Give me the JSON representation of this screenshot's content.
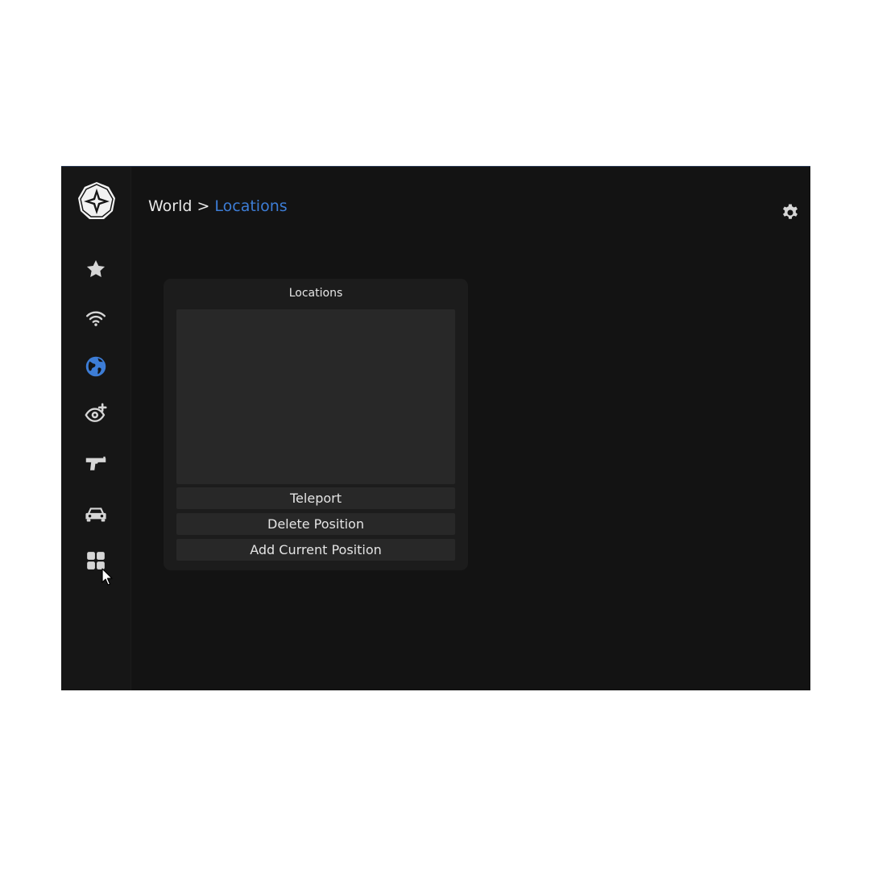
{
  "breadcrumb": {
    "parent": "World",
    "separator": ">",
    "current": "Locations"
  },
  "sidebar": {
    "items": [
      {
        "icon": "star-icon",
        "active": false
      },
      {
        "icon": "wifi-icon",
        "active": false
      },
      {
        "icon": "globe-icon",
        "active": true
      },
      {
        "icon": "eye-plus-icon",
        "active": false
      },
      {
        "icon": "pistol-icon",
        "active": false
      },
      {
        "icon": "car-icon",
        "active": false
      },
      {
        "icon": "grid-icon",
        "active": false
      }
    ]
  },
  "panel": {
    "title": "Locations",
    "buttons": {
      "teleport": "Teleport",
      "delete": "Delete Position",
      "add": "Add Current Position"
    }
  },
  "colors": {
    "accent": "#3d7dd6",
    "background": "#131313",
    "panel": "#1c1c1c",
    "control": "#282828",
    "icon": "#d6d6d6"
  }
}
